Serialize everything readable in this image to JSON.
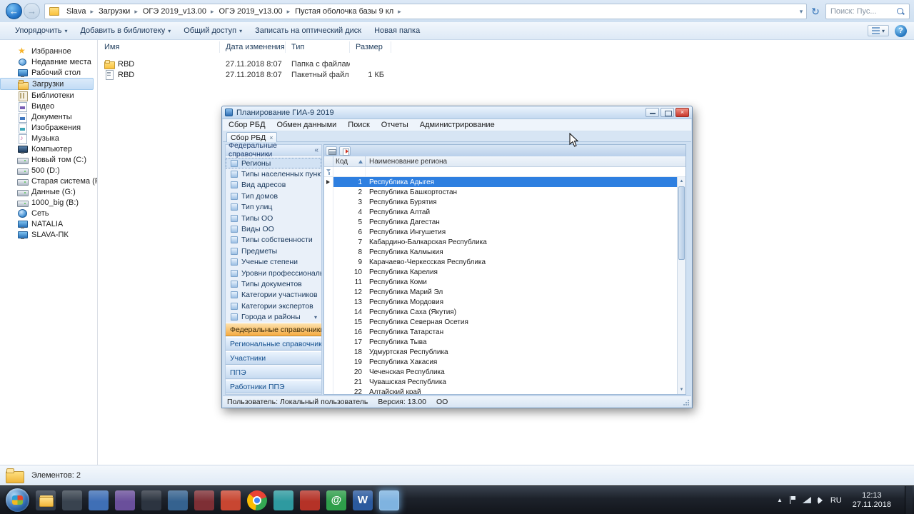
{
  "explorer": {
    "breadcrumb": [
      "Slava",
      "Загрузки",
      "ОГЭ 2019_v13.00",
      "ОГЭ 2019_v13.00",
      "Пустая оболочка базы 9 кл"
    ],
    "search_placeholder": "Поиск: Пус...",
    "toolbar": [
      {
        "label": "Упорядочить",
        "dropdown": true
      },
      {
        "label": "Добавить в библиотеку",
        "dropdown": true
      },
      {
        "label": "Общий доступ",
        "dropdown": true
      },
      {
        "label": "Записать на оптический диск",
        "dropdown": false
      },
      {
        "label": "Новая папка",
        "dropdown": false
      }
    ],
    "nav_pane": [
      {
        "kind": "section",
        "label": "Избранное",
        "icon": "ic-star"
      },
      {
        "kind": "item",
        "label": "Недавние места",
        "icon": "ic-recent"
      },
      {
        "kind": "item",
        "label": "Рабочий стол",
        "icon": "ic-desktop"
      },
      {
        "kind": "item",
        "label": "Загрузки",
        "icon": "ic-downloads",
        "selected": true
      },
      {
        "kind": "section",
        "label": "Библиотеки",
        "icon": "ic-lib"
      },
      {
        "kind": "item",
        "label": "Видео",
        "icon": "ic-video"
      },
      {
        "kind": "item",
        "label": "Документы",
        "icon": "ic-documents"
      },
      {
        "kind": "item",
        "label": "Изображения",
        "icon": "ic-pictures"
      },
      {
        "kind": "item",
        "label": "Музыка",
        "icon": "ic-music"
      },
      {
        "kind": "section",
        "label": "Компьютер",
        "icon": "ic-computer"
      },
      {
        "kind": "item",
        "label": "Новый том (C:)",
        "icon": "ic-drive"
      },
      {
        "kind": "item",
        "label": "500 (D:)",
        "icon": "ic-drive"
      },
      {
        "kind": "item",
        "label": "Старая система (F:)",
        "icon": "ic-drive"
      },
      {
        "kind": "item",
        "label": "Данные (G:)",
        "icon": "ic-drive"
      },
      {
        "kind": "item",
        "label": "1000_big (B:)",
        "icon": "ic-drive"
      },
      {
        "kind": "section",
        "label": "Сеть",
        "icon": "ic-network"
      },
      {
        "kind": "item",
        "label": "NATALIA",
        "icon": "ic-pc"
      },
      {
        "kind": "item",
        "label": "SLAVA-ПК",
        "icon": "ic-pc"
      }
    ],
    "columns": [
      "Имя",
      "Дата изменения",
      "Тип",
      "Размер"
    ],
    "files": [
      {
        "name": "RBD",
        "icon": "ic-folder",
        "date": "27.11.2018 8:07",
        "type": "Папка с файлами",
        "size": ""
      },
      {
        "name": "RBD",
        "icon": "ic-batch",
        "date": "27.11.2018 8:07",
        "type": "Пакетный файл ...",
        "size": "1 КБ"
      }
    ],
    "status": "Элементов: 2"
  },
  "app": {
    "title": "Планирование ГИА-9 2019",
    "menu": [
      "Сбор РБД",
      "Обмен данными",
      "Поиск",
      "Отчеты",
      "Администрирование"
    ],
    "tab_label": "Сбор РБД",
    "panel_header": "Федеральные справочники",
    "nav_items": [
      {
        "label": "Регионы",
        "selected": true
      },
      {
        "label": "Типы населенных пунктов"
      },
      {
        "label": "Вид адресов"
      },
      {
        "label": "Тип домов"
      },
      {
        "label": "Тип улиц"
      },
      {
        "label": "Типы ОО"
      },
      {
        "label": "Виды ОО"
      },
      {
        "label": "Типы собственности"
      },
      {
        "label": "Предметы"
      },
      {
        "label": "Ученые степени"
      },
      {
        "label": "Уровни профессионального обр..."
      },
      {
        "label": "Типы документов"
      },
      {
        "label": "Категории участников"
      },
      {
        "label": "Категории экспертов"
      },
      {
        "label": "Города и районы",
        "more": true
      }
    ],
    "groups": [
      {
        "label": "Федеральные справочники",
        "active": true
      },
      {
        "label": "Региональные справочники"
      },
      {
        "label": "Участники"
      },
      {
        "label": "ППЭ"
      },
      {
        "label": "Работники ППЭ"
      }
    ],
    "grid": {
      "columns": [
        "Код",
        "Наименование региона"
      ],
      "rows": [
        {
          "code": 1,
          "name": "Республика Адыгея",
          "selected": true
        },
        {
          "code": 2,
          "name": "Республика Башкортостан"
        },
        {
          "code": 3,
          "name": "Республика Бурятия"
        },
        {
          "code": 4,
          "name": "Республика Алтай"
        },
        {
          "code": 5,
          "name": "Республика Дагестан"
        },
        {
          "code": 6,
          "name": "Республика Ингушетия"
        },
        {
          "code": 7,
          "name": "Кабардино-Балкарская Республика"
        },
        {
          "code": 8,
          "name": "Республика Калмыкия"
        },
        {
          "code": 9,
          "name": "Карачаево-Черкесская Республика"
        },
        {
          "code": 10,
          "name": "Республика Карелия"
        },
        {
          "code": 11,
          "name": "Республика Коми"
        },
        {
          "code": 12,
          "name": "Республика Марий Эл"
        },
        {
          "code": 13,
          "name": "Республика Мордовия"
        },
        {
          "code": 14,
          "name": "Республика Саха (Якутия)"
        },
        {
          "code": 15,
          "name": "Республика Северная Осетия"
        },
        {
          "code": 16,
          "name": "Республика Татарстан"
        },
        {
          "code": 17,
          "name": "Республика Тыва"
        },
        {
          "code": 18,
          "name": "Удмуртская Республика"
        },
        {
          "code": 19,
          "name": "Республика Хакасия"
        },
        {
          "code": 20,
          "name": "Чеченская Республика"
        },
        {
          "code": 21,
          "name": "Чувашская Республика"
        },
        {
          "code": 22,
          "name": "Алтайский край"
        }
      ]
    },
    "status": {
      "user": "Пользователь: Локальный пользователь",
      "version": "Версия: 13.00",
      "mode": "ОО"
    }
  },
  "taskbar": {
    "icons": [
      {
        "name": "explorer",
        "cls": "gl-folder",
        "glyph": ""
      },
      {
        "name": "app-dark",
        "color": "#39434f",
        "glyph": ""
      },
      {
        "name": "app-blue",
        "color": "#3f6fb6",
        "glyph": ""
      },
      {
        "name": "app-violet",
        "color": "#6a4f9b",
        "glyph": ""
      },
      {
        "name": "app-slate",
        "color": "#2c3440",
        "glyph": ""
      },
      {
        "name": "app-steel",
        "color": "#35628f",
        "glyph": ""
      },
      {
        "name": "app-maroon",
        "color": "#7e2f35",
        "glyph": ""
      },
      {
        "name": "app-red",
        "color": "#c84631",
        "glyph": ""
      },
      {
        "name": "chrome",
        "cls": "gl-chrome",
        "glyph": ""
      },
      {
        "name": "app-teal",
        "color": "#2e9aa0",
        "glyph": ""
      },
      {
        "name": "app-crimson",
        "color": "#b53227",
        "glyph": ""
      },
      {
        "name": "mail",
        "color": "#2e9e4a",
        "glyph": "@"
      },
      {
        "name": "word",
        "color": "#2b5a9e",
        "glyph": "W"
      },
      {
        "name": "gia-app",
        "color": "#7fb3e0",
        "active": true,
        "glyph": ""
      }
    ],
    "tray": {
      "lang": "RU",
      "time": "12:13",
      "date": "27.11.2018"
    }
  },
  "colors": {
    "selection_blue": "#2e7fe0",
    "accordion_active_orange": "#f5ab42",
    "chrome_blue_gradient": "#d4e3f2"
  }
}
